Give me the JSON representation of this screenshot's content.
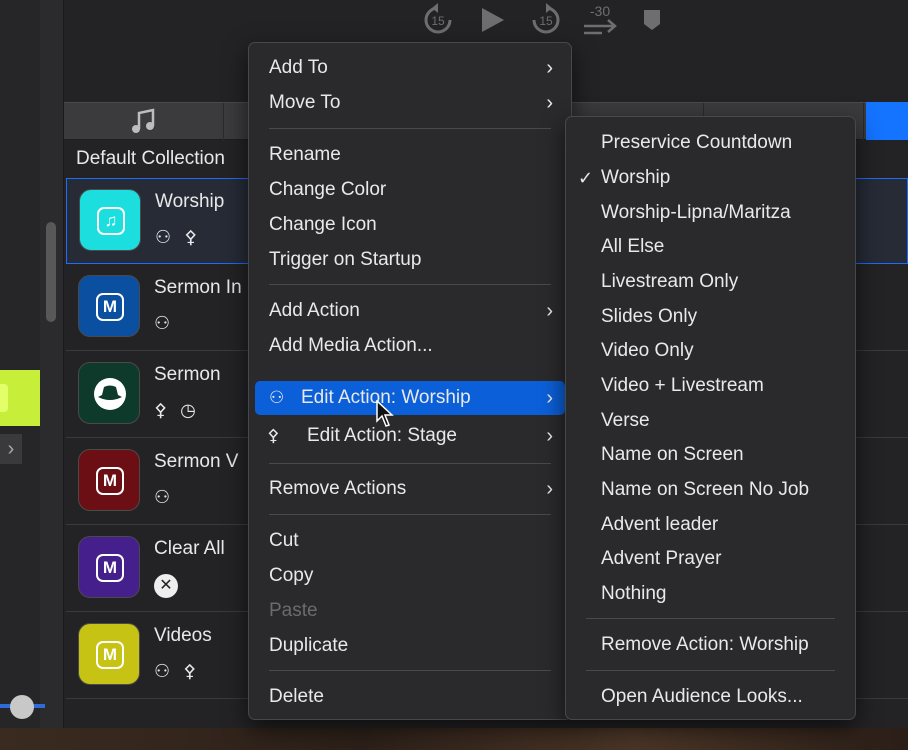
{
  "transport": {
    "rewind": "15",
    "forward": "15",
    "offset": "-30"
  },
  "collection_title": "Default Collection",
  "cues": [
    {
      "name": "Worship",
      "icon": "music-note-icon",
      "color": "#1ddede",
      "glyph": "♫",
      "actions": "⚇ ⚴"
    },
    {
      "name": "Sermon In",
      "icon": "media-m-icon",
      "color": "#0a4fa0",
      "glyph": "M",
      "actions": "⚇"
    },
    {
      "name": "Sermon",
      "icon": "hat-icon",
      "color": "#0d3a2a",
      "glyph": "⌒",
      "actions": "⚴ ◷"
    },
    {
      "name": "Sermon V",
      "icon": "media-m-icon",
      "color": "#6b0f14",
      "glyph": "M",
      "actions": "⚇"
    },
    {
      "name": "Clear All",
      "icon": "media-m-icon",
      "color": "#45208c",
      "glyph": "M",
      "actions": "✕"
    },
    {
      "name": "Videos",
      "icon": "media-m-icon",
      "color": "#c6c314",
      "glyph": "M",
      "actions": "⚇ ⚴"
    }
  ],
  "context_menu": {
    "add_to": "Add To",
    "move_to": "Move To",
    "rename": "Rename",
    "change_color": "Change Color",
    "change_icon": "Change Icon",
    "trigger_on_startup": "Trigger on Startup",
    "add_action": "Add Action",
    "add_media_action": "Add Media Action...",
    "edit_action_worship": "Edit Action: Worship",
    "edit_action_stage": "Edit Action: Stage",
    "remove_actions": "Remove Actions",
    "cut": "Cut",
    "copy": "Copy",
    "paste": "Paste",
    "duplicate": "Duplicate",
    "delete": "Delete"
  },
  "submenu": {
    "items": [
      "Preservice Countdown",
      "Worship",
      "Worship-Lipna/Maritza",
      "All Else",
      "Livestream Only",
      "Slides Only",
      "Video Only",
      "Video + Livestream",
      "Verse",
      "Name on Screen",
      "Name on Screen No Job",
      "Advent leader",
      "Advent Prayer",
      "Nothing"
    ],
    "checked": "Worship",
    "remove_action": "Remove Action: Worship",
    "open_audience_looks": "Open Audience Looks..."
  },
  "colors": {
    "accent": "#0b5fd8",
    "selection_border": "#1b6cff",
    "lime": "#c7ef3a"
  }
}
